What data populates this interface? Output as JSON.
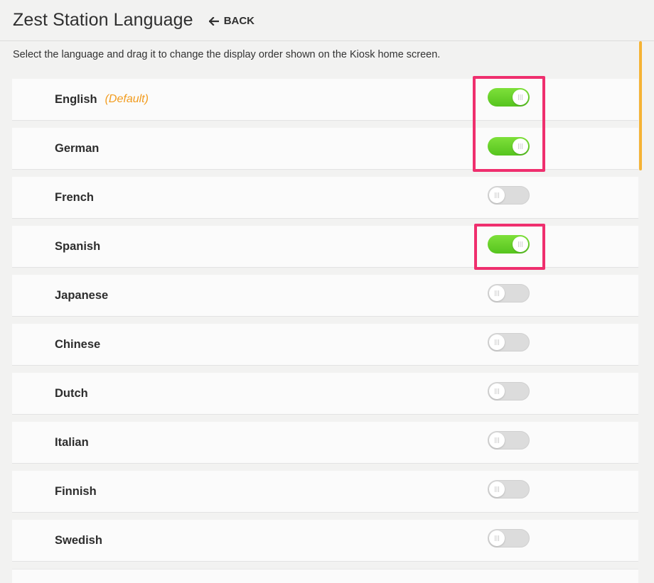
{
  "header": {
    "title": "Zest Station Language",
    "back_label": "BACK"
  },
  "instructions": "Select the language and drag it to change the display order shown on the Kiosk home screen.",
  "languages": [
    {
      "name": "English",
      "tag": "(Default)",
      "enabled": true
    },
    {
      "name": "German",
      "tag": "",
      "enabled": true
    },
    {
      "name": "French",
      "tag": "",
      "enabled": false
    },
    {
      "name": "Spanish",
      "tag": "",
      "enabled": true
    },
    {
      "name": "Japanese",
      "tag": "",
      "enabled": false
    },
    {
      "name": "Chinese",
      "tag": "",
      "enabled": false
    },
    {
      "name": "Dutch",
      "tag": "",
      "enabled": false
    },
    {
      "name": "Italian",
      "tag": "",
      "enabled": false
    },
    {
      "name": "Finnish",
      "tag": "",
      "enabled": false
    },
    {
      "name": "Swedish",
      "tag": "",
      "enabled": false
    }
  ],
  "colors": {
    "toggle_on": "#6fd22f",
    "toggle_off": "#dcdcdc",
    "default_tag": "#f29b1d",
    "highlight": "#ef2f6e",
    "scroll_indicator": "#f5b335"
  }
}
